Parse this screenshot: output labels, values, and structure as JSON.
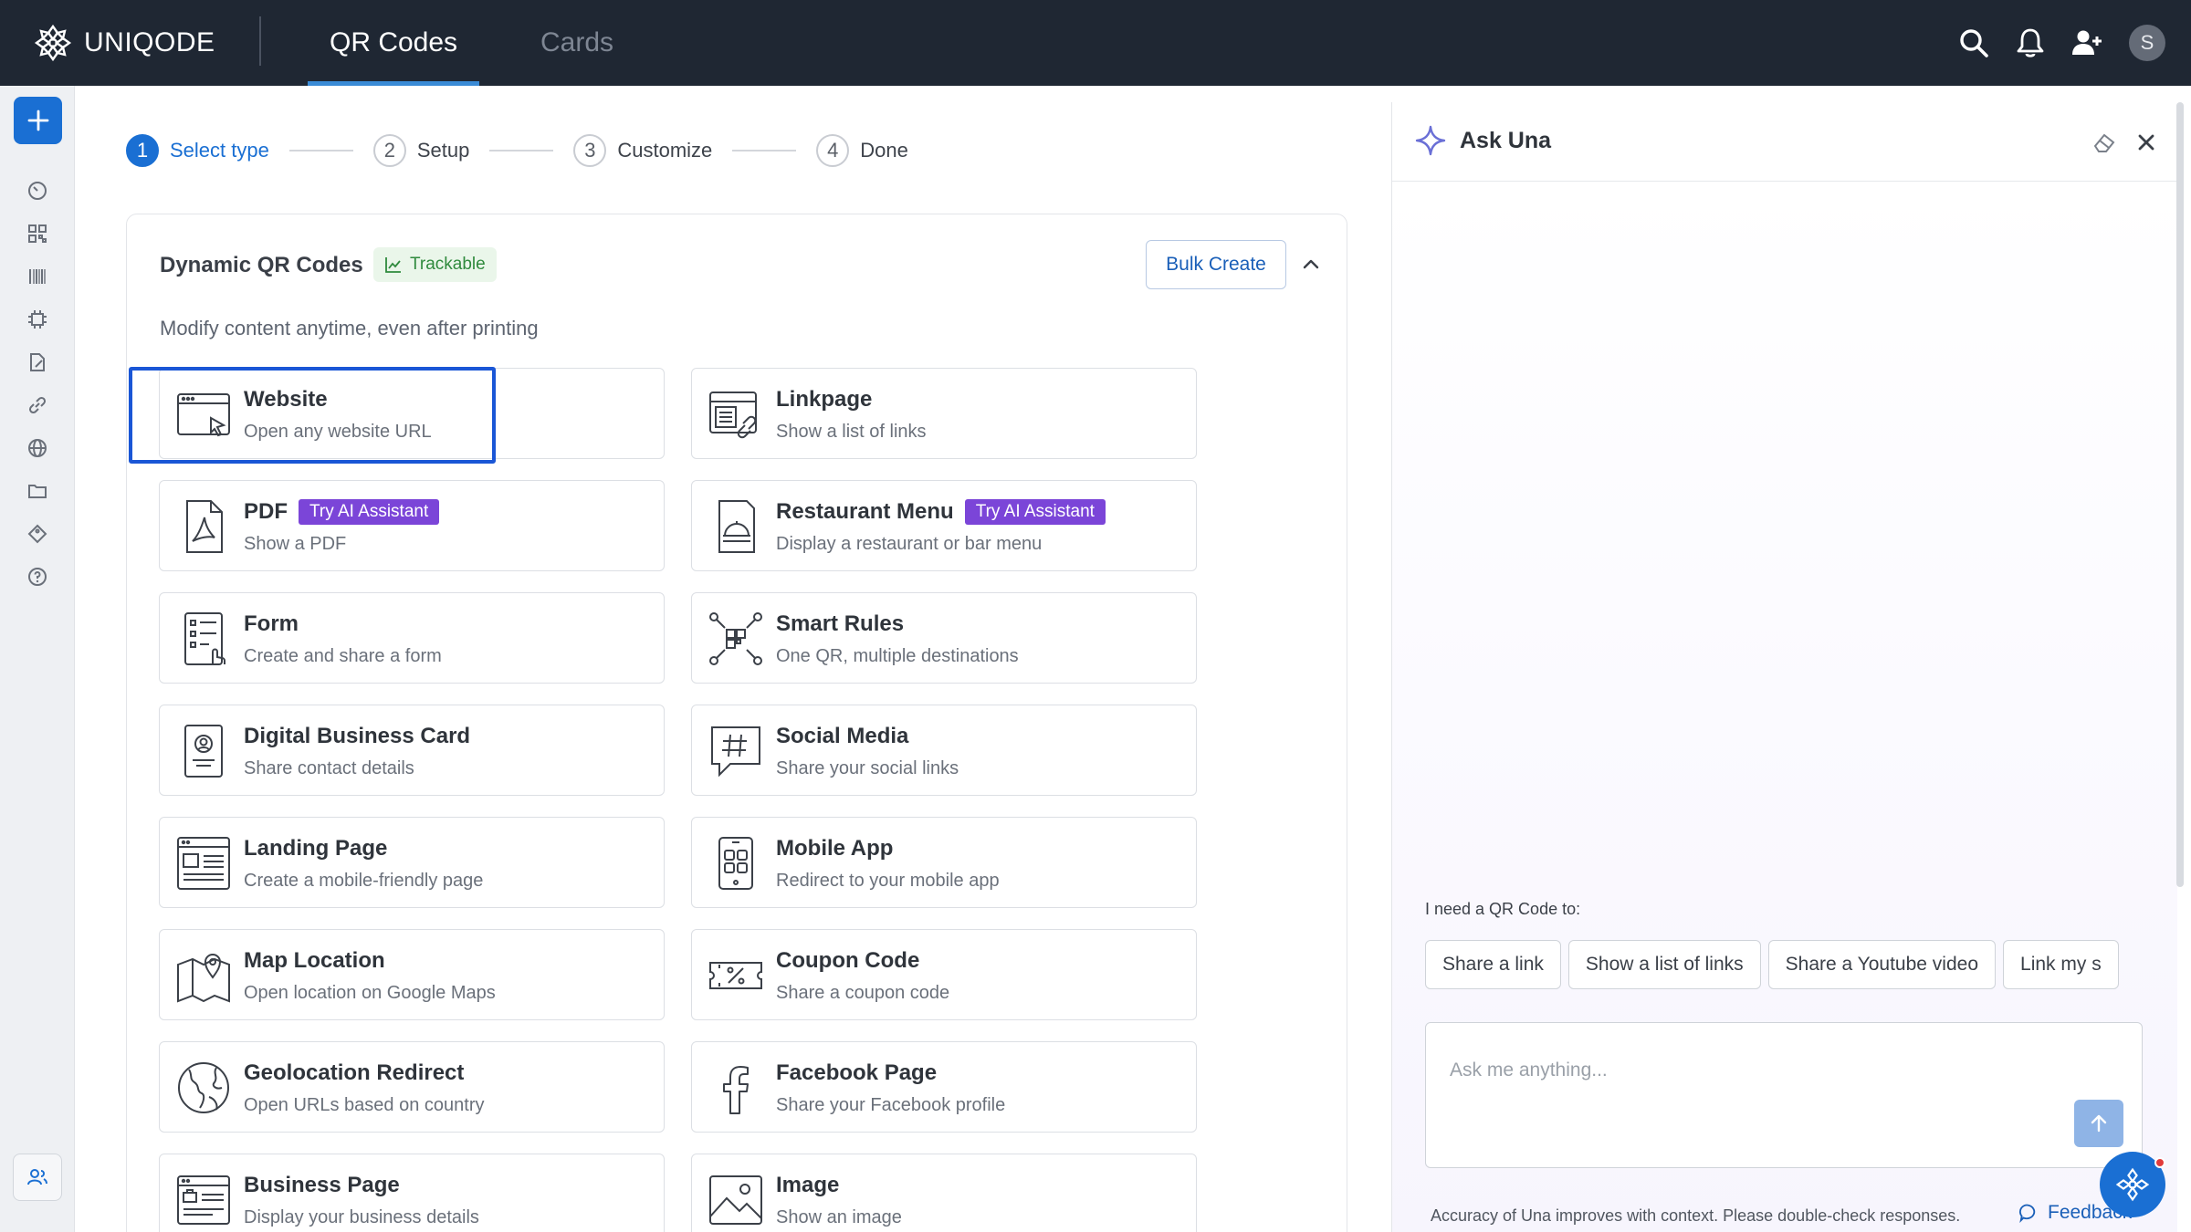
{
  "brand": {
    "name": "UNIQODE"
  },
  "nav": {
    "tabs": [
      {
        "label": "QR Codes",
        "active": true
      },
      {
        "label": "Cards",
        "active": false
      }
    ]
  },
  "header_icons": [
    "search-icon",
    "bell-icon",
    "add-user-icon"
  ],
  "user": {
    "initial": "S"
  },
  "rail": {
    "icons": [
      "dashboard-icon",
      "qr-grid-icon",
      "barcode-icon",
      "chip-icon",
      "document-edit-icon",
      "link-icon",
      "globe-icon",
      "folder-icon",
      "tag-icon",
      "help-icon"
    ]
  },
  "stepper": {
    "steps": [
      {
        "num": "1",
        "label": "Select type",
        "active": true
      },
      {
        "num": "2",
        "label": "Setup",
        "active": false
      },
      {
        "num": "3",
        "label": "Customize",
        "active": false
      },
      {
        "num": "4",
        "label": "Done",
        "active": false
      }
    ]
  },
  "section": {
    "title": "Dynamic QR Codes",
    "badge": "Trackable",
    "bulk_label": "Bulk Create",
    "subtitle": "Modify content anytime, even after printing"
  },
  "qr_types": [
    {
      "title": "Website",
      "desc": "Open any website URL",
      "icon": "browser-cursor-icon",
      "selected": true
    },
    {
      "title": "Linkpage",
      "desc": "Show a list of links",
      "icon": "linkpage-icon"
    },
    {
      "title": "PDF",
      "desc": "Show a PDF",
      "badge": "Try AI Assistant",
      "icon": "pdf-icon"
    },
    {
      "title": "Restaurant Menu",
      "desc": "Display a restaurant or bar menu",
      "badge": "Try AI Assistant",
      "icon": "menu-cloche-icon"
    },
    {
      "title": "Form",
      "desc": "Create and share a form",
      "icon": "form-icon"
    },
    {
      "title": "Smart Rules",
      "desc": "One QR, multiple destinations",
      "icon": "smart-rules-icon"
    },
    {
      "title": "Digital Business Card",
      "desc": "Share contact details",
      "icon": "contact-card-icon"
    },
    {
      "title": "Social Media",
      "desc": "Share your social links",
      "icon": "hashtag-icon"
    },
    {
      "title": "Landing Page",
      "desc": "Create a mobile-friendly page",
      "icon": "landing-page-icon"
    },
    {
      "title": "Mobile App",
      "desc": "Redirect to your mobile app",
      "icon": "mobile-app-icon"
    },
    {
      "title": "Map Location",
      "desc": "Open location on Google Maps",
      "icon": "map-pin-icon"
    },
    {
      "title": "Coupon Code",
      "desc": "Share a coupon code",
      "icon": "coupon-icon"
    },
    {
      "title": "Geolocation Redirect",
      "desc": "Open URLs based on country",
      "icon": "globe-icon"
    },
    {
      "title": "Facebook Page",
      "desc": "Share your Facebook profile",
      "icon": "facebook-icon"
    },
    {
      "title": "Business Page",
      "desc": "Display your business details",
      "icon": "business-page-icon"
    },
    {
      "title": "Image",
      "desc": "Show an image",
      "icon": "image-icon"
    }
  ],
  "assistant": {
    "title": "Ask Una",
    "prompt": "I need a QR Code to:",
    "chips": [
      "Share a link",
      "Show a list of links",
      "Share a Youtube video",
      "Link my s"
    ],
    "placeholder": "Ask me anything...",
    "disclaimer": "Accuracy of Una improves with context. Please double-check responses.",
    "feedback": "Feedback"
  },
  "colors": {
    "topbar": "#1f2733",
    "accent": "#1a6fd3",
    "ai_badge": "#7b45d8",
    "trackable": "#2f8a3d"
  }
}
